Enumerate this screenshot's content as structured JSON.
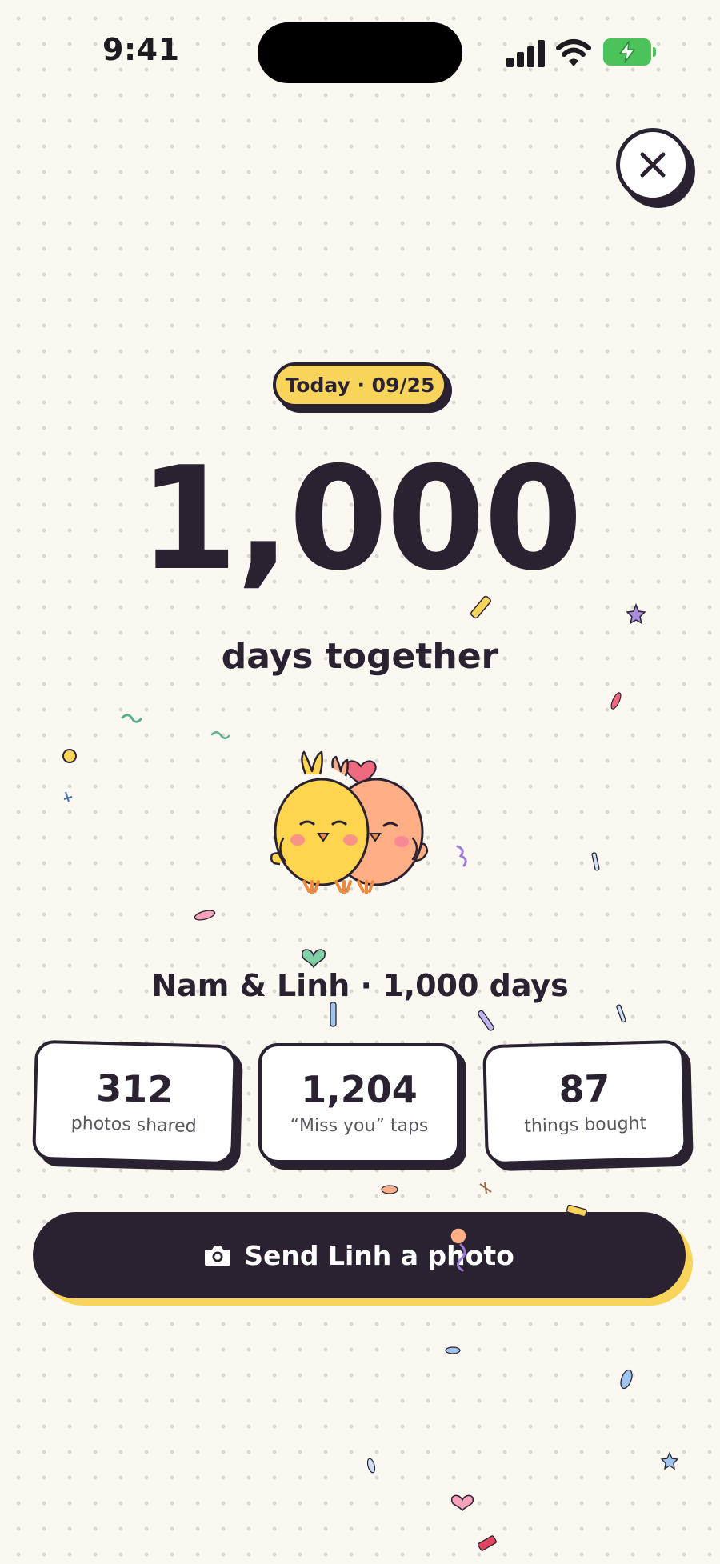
{
  "status_bar": {
    "time": "9:41"
  },
  "header": {
    "date_badge": "Today · 09/25"
  },
  "milestone": {
    "count": "1,000",
    "subtitle": "days together"
  },
  "couple_line": "Nam & Linh · 1,000 days",
  "stats": [
    {
      "value": "312",
      "label": "photos shared"
    },
    {
      "value": "1,204",
      "label": "“Miss you” taps"
    },
    {
      "value": "87",
      "label": "things bought"
    }
  ],
  "cta": {
    "label": "Send Linh a photo",
    "icon": "camera-icon"
  },
  "colors": {
    "background": "#fbf8f2",
    "ink": "#2a2230",
    "accent_yellow": "#f9d45b",
    "chick_yellow": "#ffd550",
    "chick_peach": "#ffae86",
    "heart_pink": "#f06a7f"
  }
}
